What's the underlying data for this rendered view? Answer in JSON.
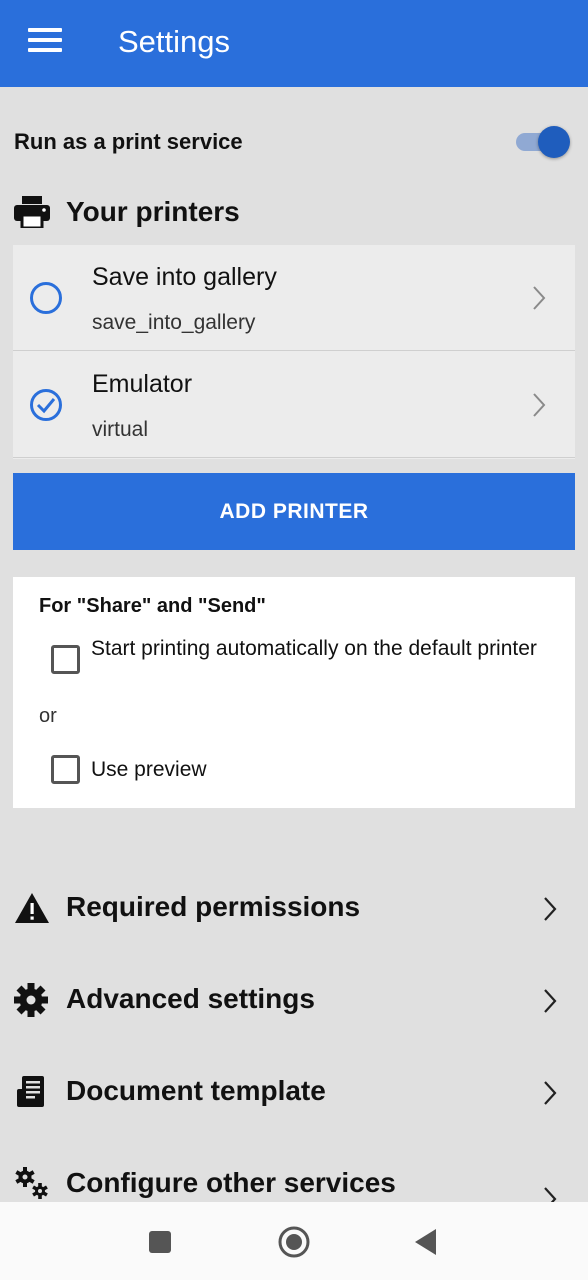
{
  "appbar": {
    "title": "Settings",
    "menu_icon": "hamburger-menu-icon"
  },
  "service": {
    "label": "Run as a print service",
    "enabled": true
  },
  "printers": {
    "heading": "Your printers",
    "items": [
      {
        "name": "Save into gallery",
        "id": "save_into_gallery",
        "selected": false
      },
      {
        "name": "Emulator",
        "id": "virtual",
        "selected": true
      }
    ],
    "add_label": "ADD PRINTER"
  },
  "share": {
    "heading": "For \"Share\" and \"Send\"",
    "option_auto": "Start printing automatically on the default printer",
    "or_label": "or",
    "option_preview": "Use preview"
  },
  "menu": [
    {
      "label": "Required permissions",
      "icon": "warning-icon"
    },
    {
      "label": "Advanced settings",
      "icon": "gear-icon"
    },
    {
      "label": "Document template",
      "icon": "document-template-icon"
    },
    {
      "label": "Configure other services",
      "icon": "gears-icon"
    }
  ],
  "colors": {
    "primary": "#2a6fdb",
    "background": "#e0e0e0",
    "toggle": "#1f5dbd"
  }
}
